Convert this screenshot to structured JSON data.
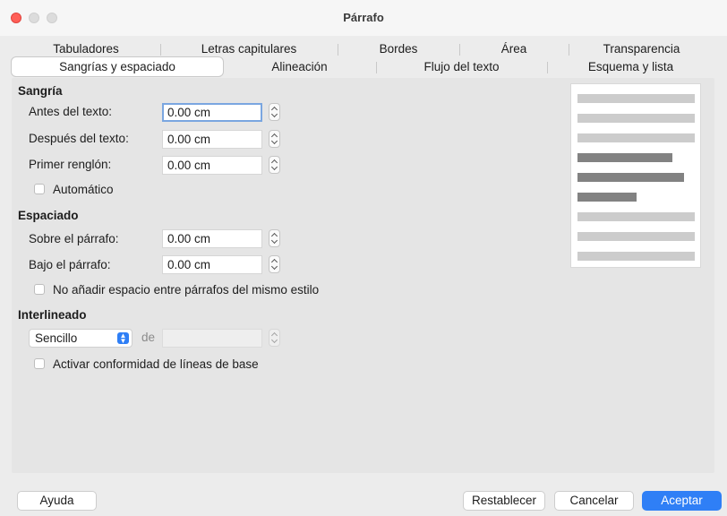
{
  "window": {
    "title": "Párrafo"
  },
  "tabs": {
    "row1": [
      "Tabuladores",
      "Letras capitulares",
      "Bordes",
      "Área",
      "Transparencia"
    ],
    "row2": [
      "Sangrías y espaciado",
      "Alineación",
      "Flujo del texto",
      "Esquema y lista"
    ],
    "active": "Sangrías y espaciado"
  },
  "indent": {
    "title": "Sangría",
    "before_label": "Antes del texto:",
    "before_value": "0.00 cm",
    "after_label": "Después del texto:",
    "after_value": "0.00 cm",
    "first_line_label": "Primer renglón:",
    "first_line_value": "0.00 cm",
    "automatic_label": "Automático"
  },
  "spacing": {
    "title": "Espaciado",
    "above_label": "Sobre el párrafo:",
    "above_value": "0.00 cm",
    "below_label": "Bajo el párrafo:",
    "below_value": "0.00 cm",
    "no_space_label": "No añadir espacio entre párrafos del mismo estilo"
  },
  "line_spacing": {
    "title": "Interlineado",
    "selected": "Sencillo",
    "of_label": "de",
    "of_value": "",
    "register_true_label": "Activar conformidad de líneas de base"
  },
  "buttons": {
    "help": "Ayuda",
    "reset": "Restablecer",
    "cancel": "Cancelar",
    "ok": "Aceptar"
  },
  "colors": {
    "accent": "#2f7ff6",
    "close": "#ff5f57"
  }
}
